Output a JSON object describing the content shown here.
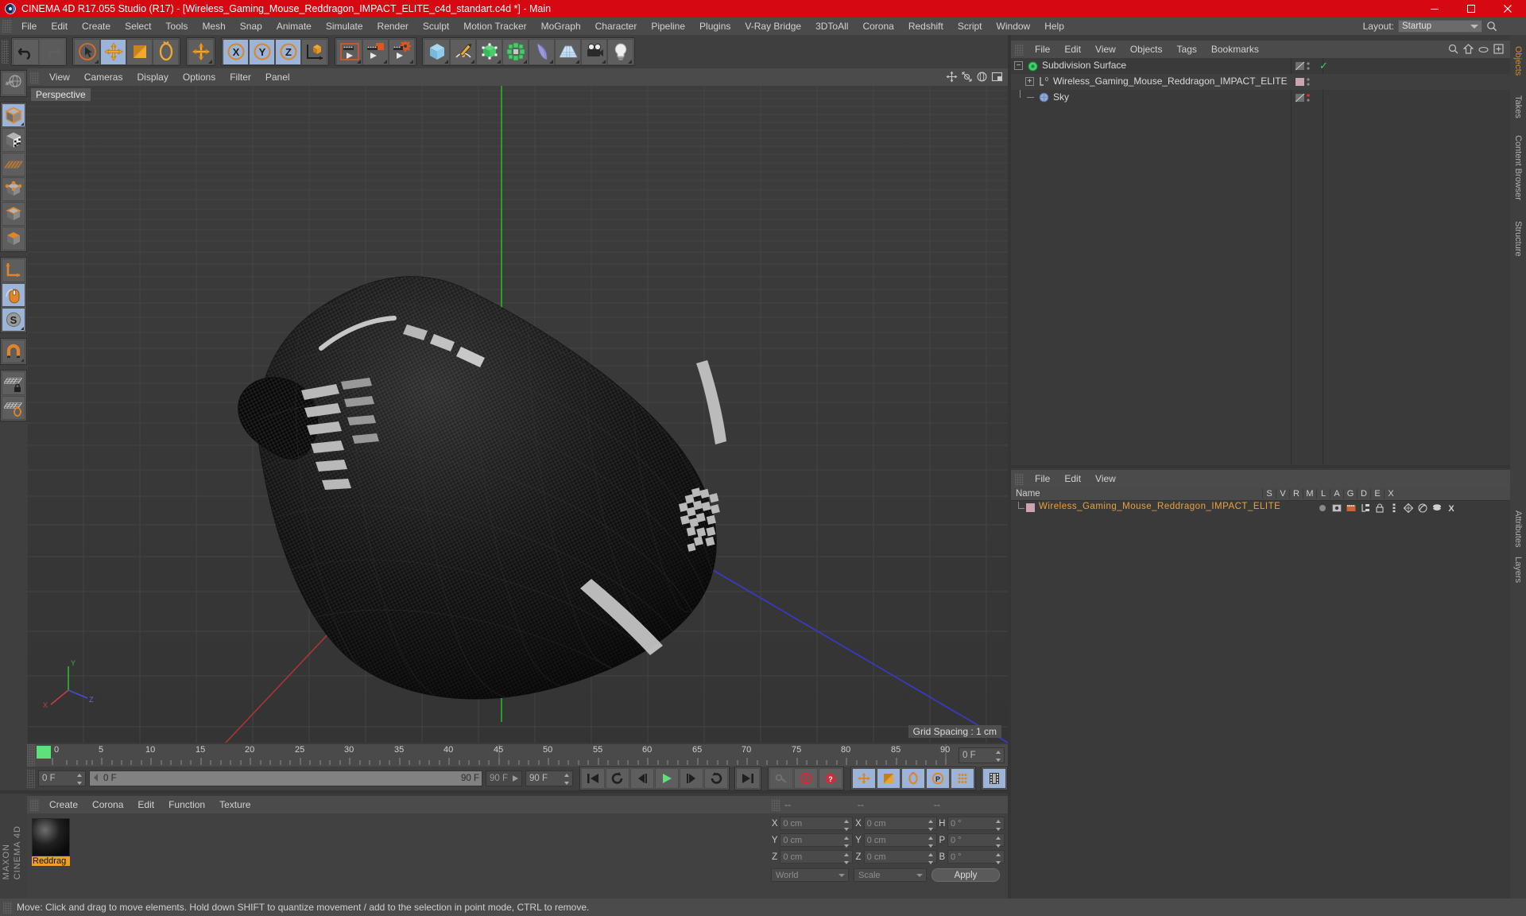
{
  "window": {
    "title": "CINEMA 4D R17.055 Studio (R17) - [Wireless_Gaming_Mouse_Reddragon_IMPACT_ELITE_c4d_standart.c4d *] - Main",
    "minimize": "—",
    "maximize": "❐",
    "close": "✕",
    "app_icon": "cinema4d-logo-icon",
    "title_bar_color": "#d60812"
  },
  "menubar": {
    "items": [
      "File",
      "Edit",
      "Create",
      "Select",
      "Tools",
      "Mesh",
      "Snap",
      "Animate",
      "Simulate",
      "Render",
      "Sculpt",
      "Motion Tracker",
      "MoGraph",
      "Character",
      "Pipeline",
      "Plugins",
      "V-Ray Bridge",
      "3DToAll",
      "Corona",
      "Redshift",
      "Script",
      "Window",
      "Help"
    ],
    "layout_label": "Layout:",
    "layout_value": "Startup",
    "search_icon": "search-icon"
  },
  "toolbar": {
    "groups": [
      {
        "name": "history",
        "buttons": [
          {
            "name": "undo-button",
            "icon": "undo-arrow-icon",
            "active": false,
            "corner": false
          },
          {
            "name": "redo-button",
            "icon": "redo-arrow-icon",
            "active": false,
            "corner": false
          }
        ]
      },
      {
        "name": "transform-tools",
        "buttons": [
          {
            "name": "live-selection-tool",
            "icon": "cursor-circle-icon",
            "active": false,
            "corner": true
          },
          {
            "name": "move-tool",
            "icon": "move-arrows-icon",
            "active": true,
            "corner": false
          },
          {
            "name": "scale-tool",
            "icon": "scale-box-icon",
            "active": false,
            "corner": false
          },
          {
            "name": "rotate-tool",
            "icon": "rotate-circle-icon",
            "active": false,
            "corner": false
          }
        ]
      },
      {
        "name": "move-alt",
        "buttons": [
          {
            "name": "move-alt-tool",
            "icon": "move-arrows-icon",
            "active": false,
            "corner": true
          }
        ]
      },
      {
        "name": "axis-locks",
        "buttons": [
          {
            "name": "x-axis-lock",
            "icon": "x-axis-icon",
            "active": true,
            "corner": false
          },
          {
            "name": "y-axis-lock",
            "icon": "y-axis-icon",
            "active": true,
            "corner": false
          },
          {
            "name": "z-axis-lock",
            "icon": "z-axis-icon",
            "active": true,
            "corner": false
          },
          {
            "name": "world-object-axis-toggle",
            "icon": "world-axis-cube-icon",
            "active": false,
            "corner": false
          }
        ]
      },
      {
        "name": "render-group",
        "buttons": [
          {
            "name": "render-view-button",
            "icon": "render-view-icon",
            "active": false,
            "corner": true
          },
          {
            "name": "render-to-picture-viewer-button",
            "icon": "render-picture-icon",
            "active": false,
            "corner": true
          },
          {
            "name": "render-settings-button",
            "icon": "render-settings-icon",
            "active": false,
            "corner": true
          }
        ]
      },
      {
        "name": "create-group",
        "buttons": [
          {
            "name": "add-cube-button",
            "icon": "cube-primitive-icon",
            "active": false,
            "corner": true
          },
          {
            "name": "add-spline-button",
            "icon": "pen-spline-icon",
            "active": false,
            "corner": true
          },
          {
            "name": "add-nurbs-button",
            "icon": "green-cube-nurbs-icon",
            "active": false,
            "corner": true
          },
          {
            "name": "add-array-button",
            "icon": "green-array-icon",
            "active": false,
            "corner": true
          },
          {
            "name": "add-deformer-button",
            "icon": "bend-deformer-icon",
            "active": false,
            "corner": true
          },
          {
            "name": "add-environment-button",
            "icon": "floor-grid-icon",
            "active": false,
            "corner": true
          },
          {
            "name": "add-camera-button",
            "icon": "camera-icon",
            "active": false,
            "corner": true
          },
          {
            "name": "add-light-button",
            "icon": "light-bulb-icon",
            "active": false,
            "corner": true
          }
        ]
      }
    ]
  },
  "left_toolbar": {
    "groups": [
      {
        "name": "undo-view",
        "buttons": [
          {
            "name": "undo-view-button",
            "icon": "globe-undo-icon",
            "active": false,
            "corner": false
          }
        ]
      },
      {
        "name": "modes",
        "buttons": [
          {
            "name": "model-mode-button",
            "icon": "model-cube-icon",
            "active": true,
            "corner": true
          },
          {
            "name": "texture-mode-button",
            "icon": "texture-checker-cube-icon",
            "active": false,
            "corner": false
          },
          {
            "name": "workplane-mode-button",
            "icon": "workplane-grid-icon",
            "active": false,
            "corner": false
          },
          {
            "name": "points-mode-button",
            "icon": "points-cube-icon",
            "active": false,
            "corner": false
          },
          {
            "name": "edges-mode-button",
            "icon": "edges-cube-icon",
            "active": false,
            "corner": false
          },
          {
            "name": "polygons-mode-button",
            "icon": "polygons-cube-icon",
            "active": false,
            "corner": false
          }
        ]
      },
      {
        "name": "axis-tools",
        "buttons": [
          {
            "name": "enable-axis-modification-button",
            "icon": "axis-arrow-icon",
            "active": false,
            "corner": false
          },
          {
            "name": "viewport-solo-button",
            "icon": "mouse-icon",
            "active": true,
            "corner": false
          },
          {
            "name": "soft-selection-button",
            "icon": "s-circle-icon",
            "active": true,
            "corner": true
          }
        ]
      },
      {
        "name": "snap-tools",
        "buttons": [
          {
            "name": "enable-snap-button",
            "icon": "magnet-icon",
            "active": false,
            "corner": true
          }
        ]
      },
      {
        "name": "lock-tools",
        "buttons": [
          {
            "name": "lock-workplane-button",
            "icon": "grid-lock-icon",
            "active": false,
            "corner": false
          },
          {
            "name": "planar-workplane-button",
            "icon": "grid-rotate-icon",
            "active": false,
            "corner": false
          }
        ]
      }
    ],
    "brand_top": "MAXON",
    "brand_bottom": "CINEMA 4D"
  },
  "viewport": {
    "menu": [
      "View",
      "Cameras",
      "Display",
      "Options",
      "Filter",
      "Panel"
    ],
    "label": "Perspective",
    "grid_spacing": "Grid Spacing : 1 cm",
    "axis_labels": {
      "x": "X",
      "y": "Y",
      "z": "Z"
    },
    "tool_icons": [
      "viewport-move-icon",
      "viewport-scale-icon",
      "viewport-rotate-icon",
      "viewport-maximize-icon"
    ]
  },
  "timeline": {
    "ticks": [
      "0",
      "5",
      "10",
      "15",
      "20",
      "25",
      "30",
      "35",
      "40",
      "45",
      "50",
      "55",
      "60",
      "65",
      "70",
      "75",
      "80",
      "85",
      "90"
    ],
    "current_frame_marker": "0",
    "frame_field_left": "0 F",
    "frame_field_preview_start": "0 F",
    "frame_field_preview_end": "90 F",
    "frame_end_small": "90 F",
    "frame_field_right": "90 F",
    "frame_field_far_right": "0 F",
    "transport": [
      {
        "name": "go-to-start-button",
        "icon": "skip-start-icon",
        "active": false
      },
      {
        "name": "play-backwards-key-button",
        "icon": "rewind-loop-icon",
        "active": false
      },
      {
        "name": "previous-frame-button",
        "icon": "step-back-icon",
        "active": false
      },
      {
        "name": "play-button",
        "icon": "play-icon",
        "active": false
      },
      {
        "name": "next-frame-button",
        "icon": "step-forward-icon",
        "active": false
      },
      {
        "name": "play-forward-loop-button",
        "icon": "forward-loop-icon",
        "active": false
      },
      {
        "name": "go-to-end-button",
        "icon": "skip-end-icon",
        "active": false
      }
    ],
    "record_tools": [
      {
        "name": "autokeying-button",
        "icon": "key-icon",
        "active": false
      },
      {
        "name": "record-active-objects-button",
        "icon": "record-circle-icon",
        "active": false
      },
      {
        "name": "keyframe-selection-button",
        "icon": "question-circle-icon",
        "active": false
      }
    ],
    "key_tools": [
      {
        "name": "position-key-button",
        "icon": "position-move-icon",
        "active": true
      },
      {
        "name": "scale-key-button",
        "icon": "scale-key-icon",
        "active": true
      },
      {
        "name": "rotation-key-button",
        "icon": "rotation-key-icon",
        "active": true
      },
      {
        "name": "parameter-key-button",
        "icon": "p-circle-icon",
        "active": true
      },
      {
        "name": "point-level-animation-button",
        "icon": "pla-dots-icon",
        "active": true
      }
    ],
    "extra_tool": {
      "name": "timeline-filmstrip-button",
      "icon": "filmstrip-icon",
      "active": true
    }
  },
  "material_manager": {
    "menu": [
      "Create",
      "Corona",
      "Edit",
      "Function",
      "Texture"
    ],
    "materials": [
      {
        "name": "Reddrag",
        "full_name": "Reddragon",
        "selected": true
      }
    ]
  },
  "coordinates_manager": {
    "header_dashes": [
      "--",
      "--",
      "--"
    ],
    "rows": [
      {
        "pos_label": "X",
        "pos_value": "0 cm",
        "size_label": "X",
        "size_value": "0 cm",
        "rot_label": "H",
        "rot_value": "0 °"
      },
      {
        "pos_label": "Y",
        "pos_value": "0 cm",
        "size_label": "Y",
        "size_value": "0 cm",
        "rot_label": "P",
        "rot_value": "0 °"
      },
      {
        "pos_label": "Z",
        "pos_value": "0 cm",
        "size_label": "Z",
        "size_value": "0 cm",
        "rot_label": "B",
        "rot_value": "0 °"
      }
    ],
    "world_select": "World",
    "scale_select": "Scale",
    "apply_button": "Apply"
  },
  "object_manager": {
    "menu": [
      "File",
      "Edit",
      "View",
      "Objects",
      "Tags",
      "Bookmarks"
    ],
    "icons": [
      "search-icon",
      "home-up-icon",
      "ellipse-icon",
      "expand-box-icon"
    ],
    "items": [
      {
        "label": "Subdivision Surface",
        "icon": "subdivision-surface-icon",
        "depth": 0,
        "expander": "minus",
        "visibility_dots": true,
        "check": true,
        "tag": "none"
      },
      {
        "label": "Wireless_Gaming_Mouse_Reddragon_IMPACT_ELITE",
        "icon": "null-object-icon",
        "depth": 1,
        "expander": "plus",
        "visibility_dots": true,
        "check": false,
        "tag": "material-pink"
      },
      {
        "label": "Sky",
        "icon": "sky-object-icon",
        "depth": 1,
        "expander": "none",
        "visibility_dots": true,
        "check": false,
        "tag": "red-dot"
      }
    ]
  },
  "attribute_manager": {
    "menu": [
      "File",
      "Edit",
      "View"
    ],
    "columns": [
      "Name",
      "S",
      "V",
      "R",
      "M",
      "L",
      "A",
      "G",
      "D",
      "E",
      "X"
    ],
    "rows": [
      {
        "name": "Wireless_Gaming_Mouse_Reddragon_IMPACT_ELITE",
        "color": "#e8a33d",
        "swatch": "#c49aa5"
      }
    ]
  },
  "dock_tabs_right": [
    {
      "label": "Objects",
      "accent": true
    },
    {
      "label": "Takes",
      "accent": false
    },
    {
      "label": "Content Browser",
      "accent": false
    },
    {
      "label": "Structure",
      "accent": false
    },
    {
      "label": "Attributes",
      "accent": false
    },
    {
      "label": "Layers",
      "accent": false
    }
  ],
  "statusbar": {
    "text": "Move: Click and drag to move elements. Hold down SHIFT to quantize movement / add to the selection in point mode, CTRL to remove."
  },
  "colors": {
    "title_red": "#d60812",
    "panel_bg": "#3f3f3f",
    "panel_dark": "#3a3a3a",
    "menu_bg": "#4b4b4b",
    "accent_blue": "#9bb4d8",
    "accent_orange": "#e8912a",
    "text": "#d0d0d0"
  }
}
